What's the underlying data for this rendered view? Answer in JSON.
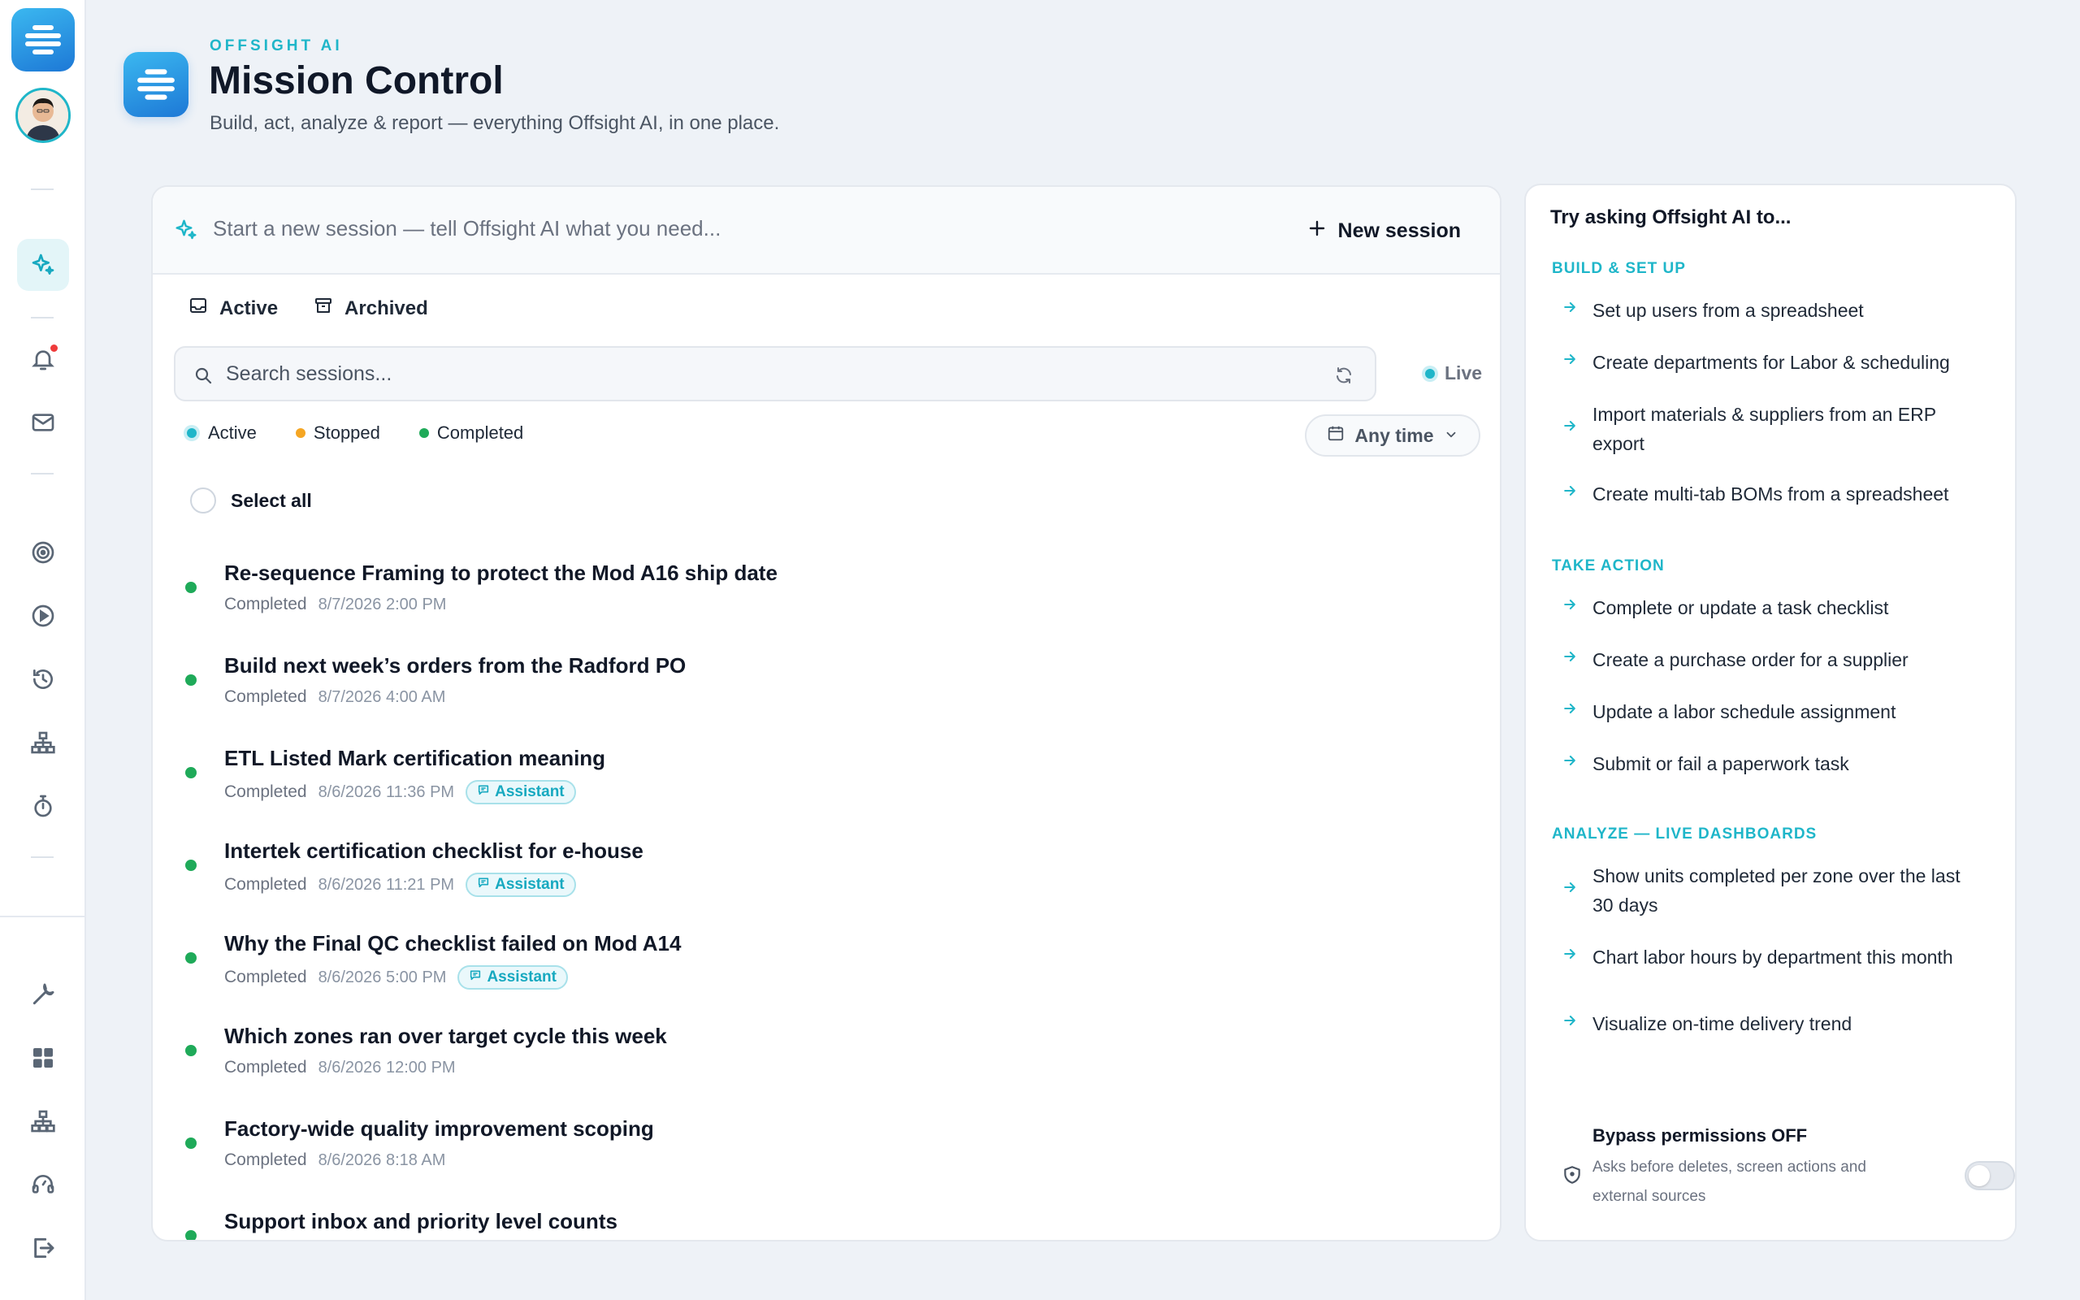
{
  "brand": {
    "kicker": "OFFSIGHT AI",
    "title": "Mission Control",
    "subtitle": "Build, act, analyze & report — everything Offsight AI, in one place."
  },
  "rail": {
    "icons": [
      "logo-icon",
      "avatar",
      "sparkle-icon",
      "bell-icon",
      "mail-icon",
      "target-icon",
      "play-icon",
      "history-icon",
      "sitemap-icon",
      "stopwatch-icon",
      "wrench-icon",
      "grid-icon",
      "network-icon",
      "support-icon",
      "logout-icon"
    ]
  },
  "session": {
    "placeholder": "Start a new session — tell Offsight AI what you need...",
    "new_label": "New session"
  },
  "tabs": [
    {
      "label": "Active"
    },
    {
      "label": "Archived"
    }
  ],
  "search": {
    "placeholder": "Search sessions...",
    "live_label": "Live"
  },
  "filters": [
    {
      "label": "Active",
      "color": "#1fb6c9"
    },
    {
      "label": "Stopped",
      "color": "#f5a623"
    },
    {
      "label": "Completed",
      "color": "#1faa59"
    }
  ],
  "time_filter": "Any time",
  "select_all": "Select all",
  "sessions": [
    {
      "title": "Re-sequence Framing to protect the Mod A16 ship date",
      "status": "Completed",
      "date": "8/7/2026 2:00 PM",
      "badge": ""
    },
    {
      "title": "Build next week’s orders from the Radford PO",
      "status": "Completed",
      "date": "8/7/2026 4:00 AM",
      "badge": ""
    },
    {
      "title": "ETL Listed Mark certification meaning",
      "status": "Completed",
      "date": "8/6/2026 11:36 PM",
      "badge": "Assistant"
    },
    {
      "title": "Intertek certification checklist for e-house",
      "status": "Completed",
      "date": "8/6/2026 11:21 PM",
      "badge": "Assistant"
    },
    {
      "title": "Why the Final QC checklist failed on Mod A14",
      "status": "Completed",
      "date": "8/6/2026 5:00 PM",
      "badge": "Assistant"
    },
    {
      "title": "Which zones ran over target cycle this week",
      "status": "Completed",
      "date": "8/6/2026 12:00 PM",
      "badge": ""
    },
    {
      "title": "Factory-wide quality improvement scoping",
      "status": "Completed",
      "date": "8/6/2026 8:18 AM",
      "badge": ""
    },
    {
      "title": "Support inbox and priority level counts",
      "status": "",
      "date": "",
      "badge": ""
    }
  ],
  "side": {
    "title": "Try asking Offsight AI to...",
    "sections": [
      {
        "heading": "BUILD & SET UP",
        "items": [
          "Set up users from a spreadsheet",
          "Create departments for Labor & scheduling",
          "Import materials & suppliers from an ERP export",
          "Create multi-tab BOMs from a spreadsheet"
        ]
      },
      {
        "heading": "TAKE ACTION",
        "items": [
          "Complete or update a task checklist",
          "Create a purchase order for a supplier",
          "Update a labor schedule assignment",
          "Submit or fail a paperwork task"
        ]
      },
      {
        "heading": "ANALYZE — LIVE DASHBOARDS",
        "items": [
          "Show units completed per zone over the last 30 days",
          "Chart labor hours by department this month",
          "Visualize on-time delivery trend"
        ]
      }
    ],
    "bypass_title": "Bypass permissions OFF",
    "bypass_sub": "Asks before deletes, screen actions and external sources",
    "bypass_on": false
  }
}
